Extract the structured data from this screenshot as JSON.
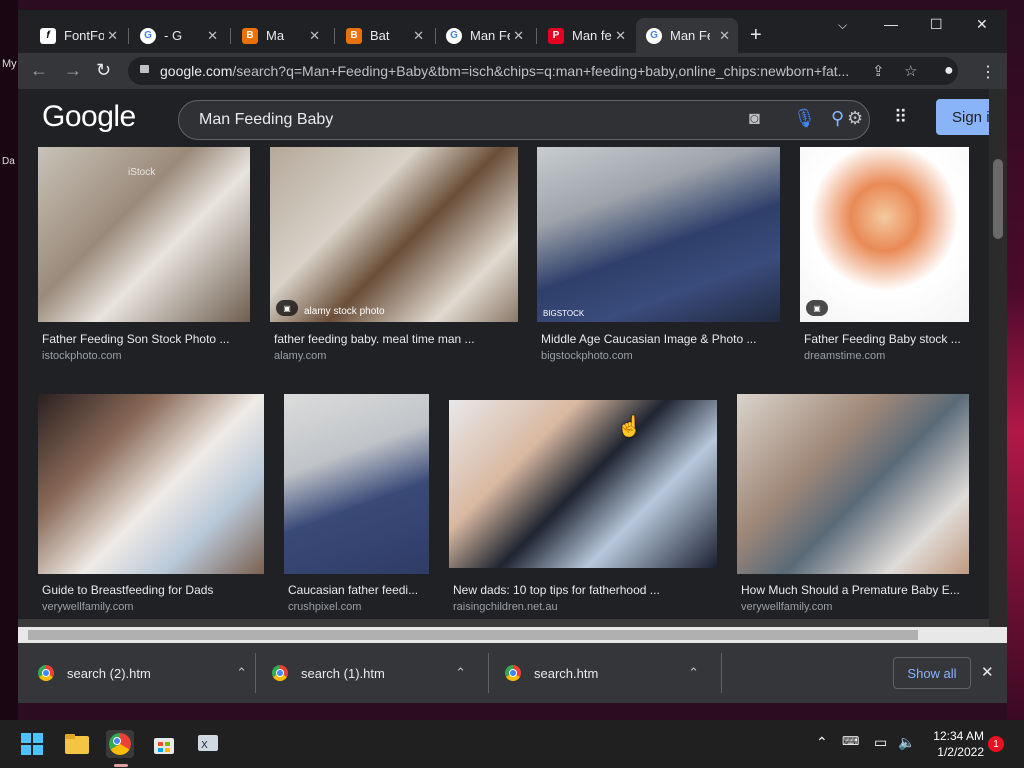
{
  "desktop": {
    "left_items": [
      "My",
      "Da"
    ]
  },
  "tabs": [
    {
      "title": "FontFo",
      "fav": "f"
    },
    {
      "title": "- G",
      "fav": "G"
    },
    {
      "title": "Ma",
      "fav": "B"
    },
    {
      "title": "Bat",
      "fav": "B"
    },
    {
      "title": "Man Fe",
      "fav": "G"
    },
    {
      "title": "Man fe",
      "fav": "P"
    },
    {
      "title": "Man Fe",
      "fav": "G"
    }
  ],
  "address": {
    "host": "google.com",
    "path": "/search?q=Man+Feeding+Baby&tbm=isch&chips=q:man+feeding+baby,online_chips:newborn+fat..."
  },
  "google": {
    "logo": "Google",
    "query": "Man Feeding Baby",
    "signin": "Sign i"
  },
  "results_row1": [
    {
      "caption": "Father Feeding Son Stock Photo ...",
      "source": "istockphoto.com"
    },
    {
      "caption": "father feeding baby. meal time man ...",
      "source": "alamy.com",
      "overlay": "alamy stock photo"
    },
    {
      "caption": "Middle Age Caucasian Image & Photo ...",
      "source": "bigstockphoto.com",
      "overlay": "BIGSTOCK"
    },
    {
      "caption": "Father Feeding Baby stock ...",
      "source": "dreamstime.com"
    }
  ],
  "results_row2": [
    {
      "caption": "Guide to Breastfeeding for Dads",
      "source": "verywellfamily.com"
    },
    {
      "caption": "Caucasian father feedi...",
      "source": "crushpixel.com"
    },
    {
      "caption": "New dads: 10 top tips for fatherhood ...",
      "source": "raisingchildren.net.au"
    },
    {
      "caption": "How Much Should a Premature Baby E...",
      "source": "verywellfamily.com"
    }
  ],
  "downloads": [
    {
      "name": "search (2).htm"
    },
    {
      "name": "search (1).htm"
    },
    {
      "name": "search.htm"
    }
  ],
  "downloads_show_all": "Show all",
  "taskbar": {
    "time": "12:34 AM",
    "date": "1/2/2022",
    "notifications": "1"
  },
  "icons": [
    "back-icon",
    "forward-icon",
    "reload-icon",
    "lock-icon",
    "share-icon",
    "star-icon",
    "profile-icon",
    "menu-icon",
    "camera-icon",
    "mic-icon",
    "search-icon",
    "settings-icon",
    "apps-icon"
  ]
}
